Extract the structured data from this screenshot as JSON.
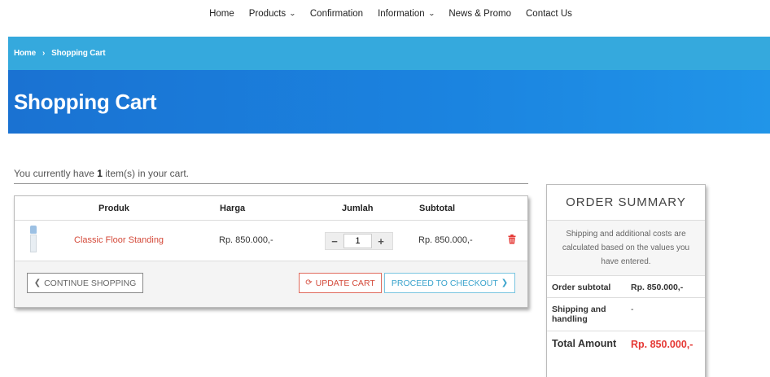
{
  "nav": {
    "items": [
      {
        "label": "Home",
        "dropdown": false
      },
      {
        "label": "Products",
        "dropdown": true
      },
      {
        "label": "Confirmation",
        "dropdown": false
      },
      {
        "label": "Information",
        "dropdown": true
      },
      {
        "label": "News & Promo",
        "dropdown": false
      },
      {
        "label": "Contact Us",
        "dropdown": false
      }
    ]
  },
  "breadcrumb": {
    "home": "Home",
    "separator": "›",
    "current": "Shopping Cart"
  },
  "page_title": "Shopping Cart",
  "cart_status": {
    "prefix": "You currently have ",
    "count": "1",
    "suffix": " item(s) in your cart."
  },
  "cart_table": {
    "headers": {
      "product": "Produk",
      "price": "Harga",
      "quantity": "Jumlah",
      "subtotal": "Subtotal"
    },
    "rows": [
      {
        "product": "Classic Floor Standing",
        "price": "Rp. 850.000,-",
        "quantity": "1",
        "subtotal": "Rp. 850.000,-"
      }
    ]
  },
  "buttons": {
    "continue": "Continue Shopping",
    "update": "Update Cart",
    "checkout": "Proceed to Checkout"
  },
  "summary": {
    "title": "ORDER SUMMARY",
    "note": "Shipping and additional costs are calculated based on the values you have entered.",
    "subtotal_label": "Order subtotal",
    "subtotal_value": "Rp. 850.000,-",
    "shipping_label": "Shipping and handling",
    "shipping_value": "-",
    "total_label": "Total Amount",
    "total_value": "Rp. 850.000,-"
  },
  "colors": {
    "breadcrumb_bg": "#35a9dd",
    "hero_bg": "#1b7fdc",
    "accent_red": "#e53935",
    "accent_cyan": "#3aa3cc"
  }
}
